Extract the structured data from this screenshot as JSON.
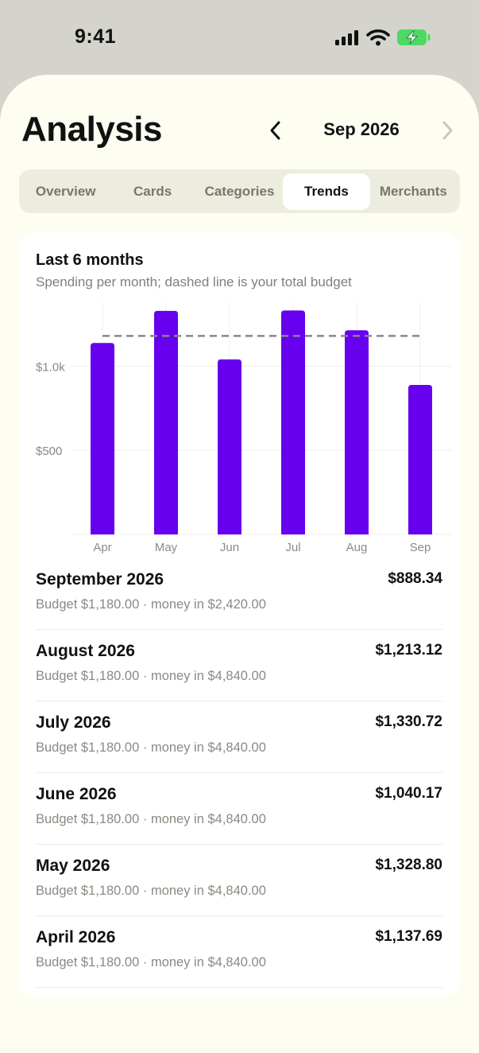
{
  "status_bar": {
    "time": "9:41"
  },
  "header": {
    "title": "Analysis",
    "month_label": "Sep 2026"
  },
  "tabs": [
    {
      "label": "Overview",
      "active": false
    },
    {
      "label": "Cards",
      "active": false
    },
    {
      "label": "Categories",
      "active": false
    },
    {
      "label": "Trends",
      "active": true
    },
    {
      "label": "Merchants",
      "active": false
    }
  ],
  "card": {
    "title": "Last 6 months",
    "subtitle": "Spending per month; dashed line is your total budget"
  },
  "chart_data": {
    "type": "bar",
    "categories": [
      "Apr",
      "May",
      "Jun",
      "Jul",
      "Aug",
      "Sep"
    ],
    "values": [
      1137.69,
      1328.8,
      1040.17,
      1330.72,
      1213.12,
      888.34
    ],
    "budget_line": 1180,
    "ytick_values": [
      500,
      1000
    ],
    "ytick_labels": [
      "$500",
      "$1.0k"
    ],
    "ylim": [
      0,
      1380
    ],
    "bar_color": "#6600ee",
    "budget_line_color": "#888888",
    "grid": true
  },
  "months": [
    {
      "title": "September 2026",
      "sub": "Budget $1,180.00 · money in $2,420.00",
      "amount": "$888.34"
    },
    {
      "title": "August 2026",
      "sub": "Budget $1,180.00 · money in $4,840.00",
      "amount": "$1,213.12"
    },
    {
      "title": "July 2026",
      "sub": "Budget $1,180.00 · money in $4,840.00",
      "amount": "$1,330.72"
    },
    {
      "title": "June 2026",
      "sub": "Budget $1,180.00 · money in $4,840.00",
      "amount": "$1,040.17"
    },
    {
      "title": "May 2026",
      "sub": "Budget $1,180.00 · money in $4,840.00",
      "amount": "$1,328.80"
    },
    {
      "title": "April 2026",
      "sub": "Budget $1,180.00 · money in $4,840.00",
      "amount": "$1,137.69"
    }
  ],
  "colors": {
    "accent": "#6600ee",
    "sheet_bg": "#fdfdf2",
    "battery": "#4cd964"
  }
}
